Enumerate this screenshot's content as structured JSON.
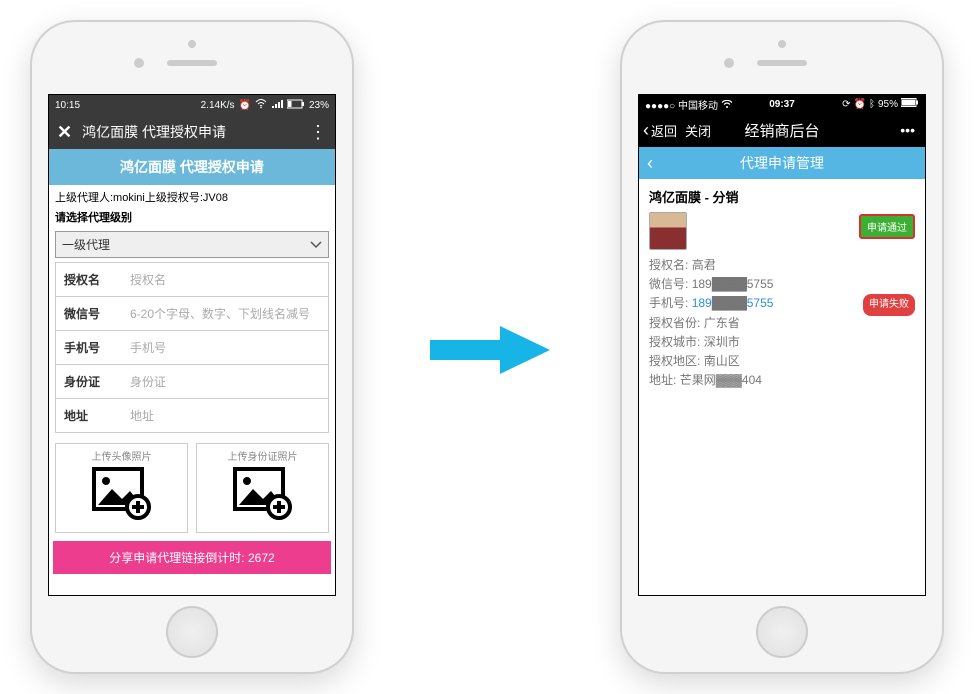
{
  "left": {
    "status": {
      "time": "10:15",
      "net_speed": "2.14K/s",
      "battery": "23%"
    },
    "nav": {
      "title": "鸿亿面膜 代理授权申请"
    },
    "banner": "鸿亿面膜 代理授权申请",
    "superior_line": "上级代理人:mokini上级授权号:JV08",
    "select_prompt": "请选择代理级别",
    "select_value": "一级代理",
    "fields": [
      {
        "label": "授权名",
        "placeholder": "授权名"
      },
      {
        "label": "微信号",
        "placeholder": "6-20个字母、数字、下划线名减号"
      },
      {
        "label": "手机号",
        "placeholder": "手机号"
      },
      {
        "label": "身份证",
        "placeholder": "身份证"
      },
      {
        "label": "地址",
        "placeholder": "地址"
      }
    ],
    "upload_avatar": "上传头像照片",
    "upload_id": "上传身份证照片",
    "countdown_label": "分享申请代理链接倒计时:",
    "countdown_value": "2672"
  },
  "right": {
    "status": {
      "carrier": "中国移动",
      "time": "09:37",
      "battery": "95%"
    },
    "nav": {
      "back": "返回",
      "close": "关闭",
      "title": "经销商后台"
    },
    "section_title": "代理申请管理",
    "detail_title": "鸿亿面膜 - 分销",
    "badge_pass": "申请通过",
    "badge_fail": "申请失败",
    "rows": {
      "auth_name": {
        "k": "授权名:",
        "v": "高君"
      },
      "wechat": {
        "k": "微信号:",
        "v_pre": "189",
        "v_mask": "▓▓▓▓",
        "v_suf": "5755"
      },
      "phone": {
        "k": "手机号:",
        "v_pre": "189",
        "v_mask": "▓▓▓▓",
        "v_suf": "5755"
      },
      "province": {
        "k": "授权省份:",
        "v": "广东省"
      },
      "city": {
        "k": "授权城市:",
        "v": "深圳市"
      },
      "district": {
        "k": "授权地区:",
        "v": "南山区"
      },
      "address": {
        "k": "地址:",
        "v": "芒果网▓▓▓404"
      }
    }
  }
}
